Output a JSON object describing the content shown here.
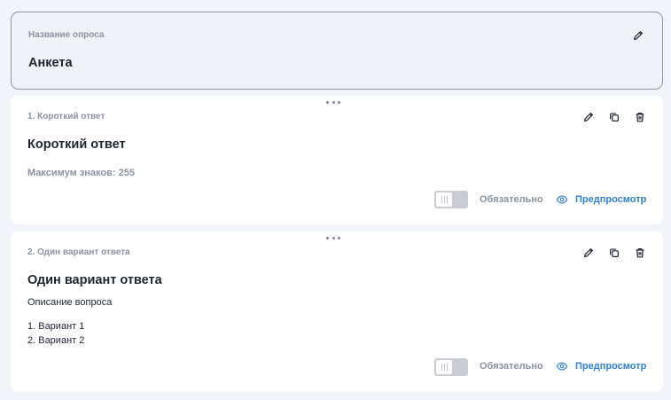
{
  "survey": {
    "name_label": "Название опроса",
    "name_value": "Анкета",
    "edit_icon": "pencil-icon"
  },
  "questions": [
    {
      "header": "1. Короткий ответ",
      "title": "Короткий ответ",
      "meta": "Максимум знаков: 255",
      "required_label": "Обязательно",
      "required": false,
      "preview_label": "Предпросмотр"
    },
    {
      "header": "2. Один вариант ответа",
      "title": "Один вариант ответа",
      "description": "Описание вопроса",
      "options": [
        "1. Вариант 1",
        "2. Вариант 2"
      ],
      "required_label": "Обязательно",
      "required": false,
      "preview_label": "Предпросмотр"
    }
  ],
  "icons": {
    "edit": "pencil-icon",
    "copy": "copy-icon",
    "delete": "trash-icon",
    "drag": "drag-handle-icon",
    "preview": "eye-icon"
  },
  "colors": {
    "accent": "#2f80d6",
    "muted": "#8b93a1",
    "background": "#f1f4f8",
    "toggle_off": "#c9cdd3"
  }
}
